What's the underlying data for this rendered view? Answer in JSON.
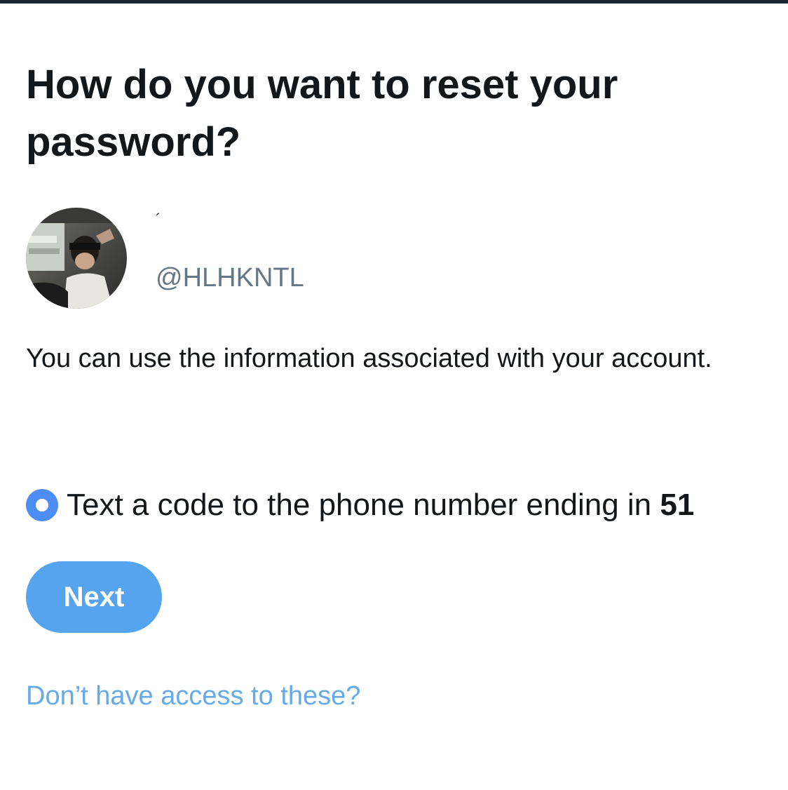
{
  "header": {
    "title": "How do you want to reset your password?"
  },
  "account": {
    "avatar_icon": "user-avatar-photo",
    "display_name": "´",
    "handle": "@HLHKNTL"
  },
  "info": {
    "text": "You can use the information associated with your account."
  },
  "options": [
    {
      "label_prefix": "Text a code to the phone number ending in ",
      "label_suffix": "51",
      "selected": true
    }
  ],
  "actions": {
    "next_label": "Next",
    "help_link": "Don’t have access to these?"
  },
  "colors": {
    "accent": "#4d8ef5",
    "button": "#57a4ee",
    "link": "#67aae8",
    "text": "#14171a",
    "muted": "#657786"
  }
}
